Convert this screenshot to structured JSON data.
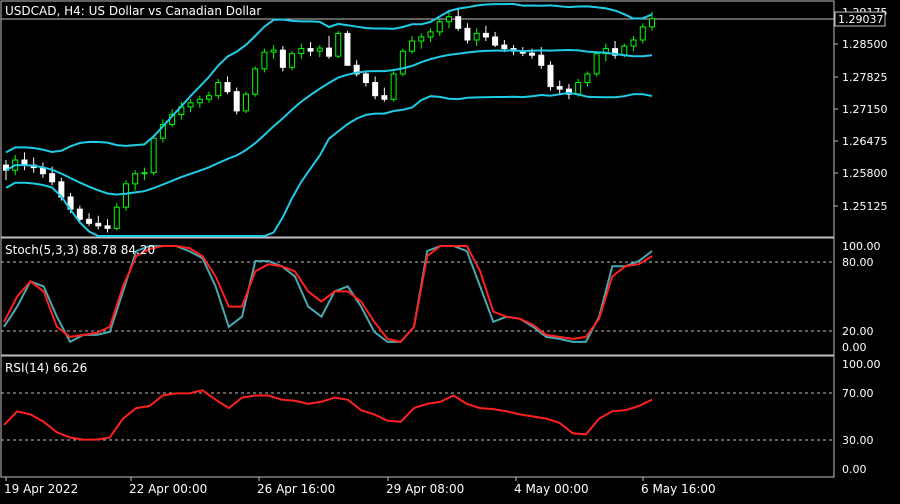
{
  "window": {
    "title": "USDCAD, H4:  US Dollar vs Canadian Dollar",
    "current_price": "1.29037"
  },
  "price_axis": {
    "ticks": [
      "1.29175",
      "1.28500",
      "1.27825",
      "1.27150",
      "1.26475",
      "1.25800",
      "1.25125"
    ]
  },
  "time_axis": {
    "labels": [
      "19 Apr 2022",
      "22 Apr 00:00",
      "26 Apr 16:00",
      "29 Apr 08:00",
      "4 May 00:00",
      "6 May 16:00"
    ]
  },
  "stochastic": {
    "label": "Stoch(5,3,3) 88.78 84.20",
    "ticks": [
      "100.00",
      "80.00",
      "20.00",
      "0.00"
    ]
  },
  "rsi": {
    "label": "RSI(14) 66.26",
    "ticks": [
      "100.00",
      "70.00",
      "30.00",
      "0.00"
    ]
  },
  "colors": {
    "background": "#000000",
    "grid": "#c0c0c0",
    "bull_candle": "#00ff00",
    "bear_candle": "#ffffff",
    "bollinger": "#1ecce6",
    "stoch_main": "#4aa8b0",
    "stoch_signal": "#ff2020",
    "rsi": "#ff2020",
    "text": "#ffffff"
  },
  "chart_data": [
    {
      "type": "candlestick",
      "title": "USDCAD, H4:  US Dollar vs Canadian Dollar",
      "y_range": [
        1.2475,
        1.2937
      ],
      "ohlc": [
        [
          1.2615,
          1.2625,
          1.2585,
          1.2605
        ],
        [
          1.2605,
          1.2635,
          1.2595,
          1.2625
        ],
        [
          1.2625,
          1.264,
          1.2605,
          1.2615
        ],
        [
          1.2615,
          1.263,
          1.26,
          1.261
        ],
        [
          1.261,
          1.262,
          1.259,
          1.2598
        ],
        [
          1.2598,
          1.2612,
          1.2575,
          1.2582
        ],
        [
          1.2582,
          1.259,
          1.2545,
          1.2552
        ],
        [
          1.2552,
          1.256,
          1.252,
          1.2528
        ],
        [
          1.2528,
          1.2535,
          1.25,
          1.2508
        ],
        [
          1.2508,
          1.252,
          1.2495,
          1.25
        ],
        [
          1.25,
          1.2515,
          1.2488,
          1.2495
        ],
        [
          1.2495,
          1.2508,
          1.2482,
          1.249
        ],
        [
          1.249,
          1.254,
          1.2486,
          1.2532
        ],
        [
          1.2532,
          1.2585,
          1.2525,
          1.2578
        ],
        [
          1.2578,
          1.2605,
          1.2565,
          1.2598
        ],
        [
          1.2598,
          1.261,
          1.2585,
          1.26
        ],
        [
          1.26,
          1.2675,
          1.2595,
          1.2668
        ],
        [
          1.2668,
          1.2705,
          1.266,
          1.2695
        ],
        [
          1.2695,
          1.2725,
          1.269,
          1.2715
        ],
        [
          1.2715,
          1.274,
          1.2705,
          1.273
        ],
        [
          1.273,
          1.2745,
          1.272,
          1.2738
        ],
        [
          1.2738,
          1.2752,
          1.2728,
          1.2745
        ],
        [
          1.2745,
          1.276,
          1.2738,
          1.2752
        ],
        [
          1.2752,
          1.2785,
          1.2745,
          1.2778
        ],
        [
          1.2778,
          1.279,
          1.2755,
          1.276
        ],
        [
          1.276,
          1.2768,
          1.2715,
          1.2722
        ],
        [
          1.2722,
          1.276,
          1.2718,
          1.2755
        ],
        [
          1.2755,
          1.281,
          1.275,
          1.2805
        ],
        [
          1.2805,
          1.2845,
          1.2798,
          1.2838
        ],
        [
          1.2838,
          1.2852,
          1.2825,
          1.2842
        ],
        [
          1.2842,
          1.285,
          1.28,
          1.2808
        ],
        [
          1.2808,
          1.284,
          1.2802,
          1.2835
        ],
        [
          1.2835,
          1.2855,
          1.2825,
          1.2845
        ],
        [
          1.2845,
          1.2858,
          1.283,
          1.284
        ],
        [
          1.284,
          1.2852,
          1.2828,
          1.2846
        ],
        [
          1.2846,
          1.287,
          1.2825,
          1.283
        ],
        [
          1.283,
          1.288,
          1.2826,
          1.2875
        ],
        [
          1.2875,
          1.288,
          1.282,
          1.2812
        ],
        [
          1.2812,
          1.2822,
          1.279,
          1.2795
        ],
        [
          1.2795,
          1.28,
          1.277,
          1.2778
        ],
        [
          1.2778,
          1.279,
          1.2745,
          1.2752
        ],
        [
          1.2752,
          1.2768,
          1.274,
          1.2745
        ],
        [
          1.2745,
          1.28,
          1.274,
          1.2795
        ],
        [
          1.2795,
          1.2845,
          1.279,
          1.284
        ],
        [
          1.284,
          1.287,
          1.2835,
          1.286
        ],
        [
          1.286,
          1.2875,
          1.2845,
          1.2868
        ],
        [
          1.2868,
          1.2885,
          1.2858,
          1.2878
        ],
        [
          1.2878,
          1.2905,
          1.287,
          1.2898
        ],
        [
          1.2898,
          1.292,
          1.2885,
          1.2908
        ],
        [
          1.2908,
          1.2925,
          1.288,
          1.2885
        ],
        [
          1.2885,
          1.2895,
          1.2855,
          1.2862
        ],
        [
          1.2862,
          1.2885,
          1.285,
          1.2875
        ],
        [
          1.2875,
          1.289,
          1.286,
          1.2868
        ],
        [
          1.2868,
          1.2878,
          1.2848,
          1.2852
        ],
        [
          1.2852,
          1.2862,
          1.2838,
          1.2845
        ],
        [
          1.2845,
          1.2852,
          1.2832,
          1.284
        ],
        [
          1.284,
          1.2848,
          1.283,
          1.2836
        ],
        [
          1.2836,
          1.2845,
          1.2825,
          1.2832
        ],
        [
          1.2832,
          1.2848,
          1.2805,
          1.2812
        ],
        [
          1.2812,
          1.282,
          1.2762,
          1.277
        ],
        [
          1.277,
          1.2782,
          1.2755,
          1.2765
        ],
        [
          1.2765,
          1.2775,
          1.2745,
          1.2755
        ],
        [
          1.2755,
          1.2785,
          1.275,
          1.2778
        ],
        [
          1.2778,
          1.28,
          1.277,
          1.2795
        ],
        [
          1.2795,
          1.284,
          1.279,
          1.2835
        ],
        [
          1.2835,
          1.2855,
          1.282,
          1.2845
        ],
        [
          1.2845,
          1.286,
          1.2825,
          1.2832
        ],
        [
          1.2832,
          1.2855,
          1.2828,
          1.285
        ],
        [
          1.285,
          1.287,
          1.284,
          1.2862
        ],
        [
          1.2862,
          1.2895,
          1.2855,
          1.2888
        ],
        [
          1.2888,
          1.2918,
          1.288,
          1.2904
        ]
      ]
    },
    {
      "type": "line",
      "title": "Stoch(5,3,3) 88.78 84.20",
      "y_range": [
        0,
        100
      ],
      "series": [
        {
          "name": "main",
          "values": [
            20,
            40,
            65,
            60,
            30,
            5,
            12,
            12,
            15,
            55,
            95,
            100,
            100,
            100,
            95,
            88,
            60,
            20,
            30,
            85,
            85,
            80,
            70,
            40,
            30,
            55,
            60,
            40,
            15,
            5,
            5,
            20,
            95,
            100,
            100,
            95,
            60,
            25,
            30,
            28,
            20,
            10,
            8,
            5,
            5,
            30,
            80,
            80,
            85,
            95
          ]
        },
        {
          "name": "signal",
          "values": [
            25,
            50,
            65,
            55,
            20,
            10,
            12,
            14,
            20,
            60,
            90,
            97,
            100,
            100,
            98,
            90,
            70,
            40,
            40,
            75,
            82,
            80,
            75,
            55,
            45,
            55,
            55,
            45,
            25,
            8,
            5,
            20,
            90,
            100,
            100,
            100,
            75,
            35,
            30,
            28,
            22,
            12,
            10,
            8,
            10,
            28,
            70,
            80,
            82,
            90
          ]
        }
      ]
    },
    {
      "type": "line",
      "title": "RSI(14) 66.26",
      "y_range": [
        0,
        100
      ],
      "series": [
        {
          "name": "RSI(14)",
          "values": [
            42,
            55,
            52,
            45,
            35,
            30,
            28,
            28,
            30,
            48,
            58,
            60,
            70,
            72,
            72,
            75,
            66,
            58,
            68,
            70,
            70,
            66,
            65,
            62,
            64,
            68,
            66,
            56,
            52,
            46,
            45,
            58,
            62,
            64,
            70,
            62,
            58,
            57,
            55,
            52,
            50,
            48,
            44,
            34,
            33,
            48,
            55,
            56,
            60,
            66
          ]
        }
      ]
    }
  ]
}
